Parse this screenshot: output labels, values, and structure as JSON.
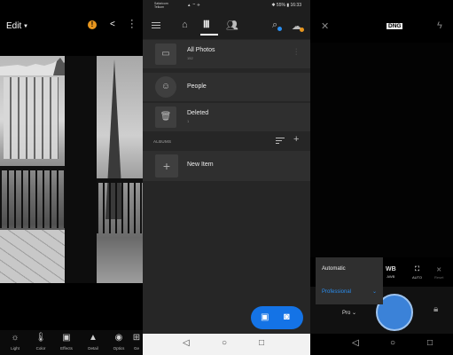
{
  "edit_screen": {
    "title": "Edit",
    "tools": [
      {
        "label": "Light",
        "icon": "sun-icon"
      },
      {
        "label": "Color",
        "icon": "thermometer-icon"
      },
      {
        "label": "Effects",
        "icon": "effects-icon"
      },
      {
        "label": "Detail",
        "icon": "triangle-icon"
      },
      {
        "label": "Optics",
        "icon": "lens-icon"
      },
      {
        "label": "Ge",
        "icon": "geometry-icon"
      }
    ]
  },
  "library_screen": {
    "status": {
      "carrier": "Safaricom\nTelkom",
      "speed": "1.6\nK/s",
      "battery": "55%",
      "time": "16:33"
    },
    "items": [
      {
        "title": "All Photos",
        "count": "152",
        "icon": "photos-icon"
      },
      {
        "title": "People",
        "count": "",
        "icon": "people-icon"
      },
      {
        "title": "Deleted",
        "count": "1",
        "icon": "trash-icon"
      }
    ],
    "albums_label": "ALBUMS",
    "new_item_label": "New Item"
  },
  "camera_screen": {
    "format_badge": "DNG",
    "controls": [
      {
        "label": "WB",
        "sub": "AWB"
      },
      {
        "label": "⛶",
        "sub": "AUTO"
      },
      {
        "label": "✕",
        "sub": "Reset"
      }
    ],
    "menu": {
      "options": [
        "Automatic",
        "Professional"
      ],
      "selected": "Professional"
    },
    "mode_label": "Pro"
  },
  "colors": {
    "accent_blue": "#1473e6",
    "warning_orange": "#e8961e",
    "shutter_blue": "#3b82d8"
  }
}
